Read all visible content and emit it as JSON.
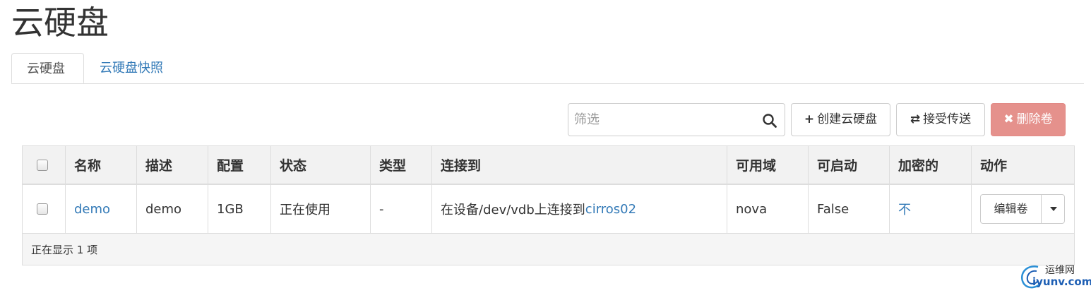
{
  "page": {
    "title": "云硬盘"
  },
  "tabs": [
    {
      "label": "云硬盘",
      "active": true
    },
    {
      "label": "云硬盘快照",
      "active": false
    }
  ],
  "toolbar": {
    "search_placeholder": "筛选",
    "create_label": "创建云硬盘",
    "create_icon": "+",
    "accept_label": "接受传送",
    "accept_icon": "⇄",
    "delete_label": "删除卷",
    "delete_icon": "✖",
    "delete_color": "#e5918c"
  },
  "table": {
    "headers": [
      "名称",
      "描述",
      "配置",
      "状态",
      "类型",
      "连接到",
      "可用域",
      "可启动",
      "加密的",
      "动作"
    ],
    "rows": [
      {
        "name": "demo",
        "description": "demo",
        "size": "1GB",
        "status": "正在使用",
        "type": "-",
        "attached_prefix": "在设备/dev/vdb上连接到",
        "attached_link": "cirros02",
        "zone": "nova",
        "bootable": "False",
        "encrypted": "不",
        "action_label": "编辑卷"
      }
    ],
    "footer": "正在显示 1 项"
  },
  "watermark": {
    "line1": "运维网",
    "line2": "iyunv.com"
  },
  "colors": {
    "link": "#337ab7",
    "danger": "#e5918c"
  }
}
